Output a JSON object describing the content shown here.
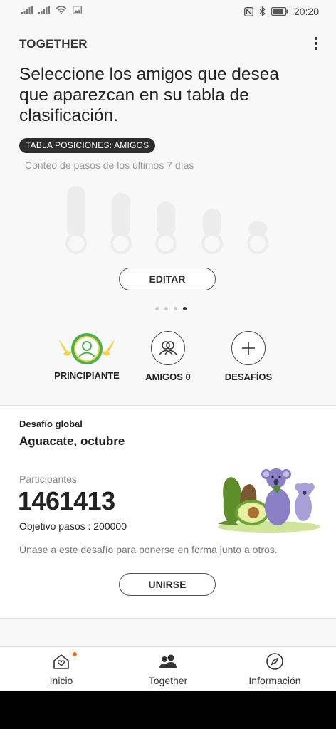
{
  "status_bar": {
    "time": "20:20",
    "icons": [
      "signal-icon",
      "signal-icon",
      "wifi-icon",
      "image-icon",
      "nfc-icon",
      "bluetooth-icon",
      "battery-icon"
    ]
  },
  "app_bar": {
    "title": "TOGETHER",
    "more_icon": "more-vert-icon"
  },
  "leaderboard": {
    "headline": "Seleccione los amigos que desea que aparezcan en su tabla de clasificación.",
    "pill": "TABLA POSICIONES: AMIGOS",
    "subtitle": "Conteo de pasos de los últimos 7 días",
    "edit_label": "EDITAR",
    "page_count": 4,
    "active_page": 4
  },
  "shortcuts": [
    {
      "label": "PRINCIPIANTE",
      "icon": "beginner-badge-icon"
    },
    {
      "label": "AMIGOS 0",
      "icon": "friends-icon"
    },
    {
      "label": "DESAFÍOS",
      "icon": "plus-icon"
    }
  ],
  "challenge": {
    "section_label": "Desafío global",
    "title": "Aguacate, octubre",
    "participants_label": "Participantes",
    "participants_count": "1461413",
    "goal": "Objetivo pasos : 200000",
    "description": "Únase a este desafío para ponerse en forma junto a otros.",
    "join_label": "UNIRSE"
  },
  "bottom_nav": [
    {
      "label": "Inicio",
      "icon": "home-heart-icon",
      "has_badge": true
    },
    {
      "label": "Together",
      "icon": "people-icon",
      "has_badge": false
    },
    {
      "label": "Información",
      "icon": "compass-icon",
      "has_badge": false
    }
  ],
  "colors": {
    "accent": "#f26b1d",
    "badge_green": "#4caf50",
    "badge_yellow": "#f3d24a",
    "background": "#f8f8f8"
  }
}
